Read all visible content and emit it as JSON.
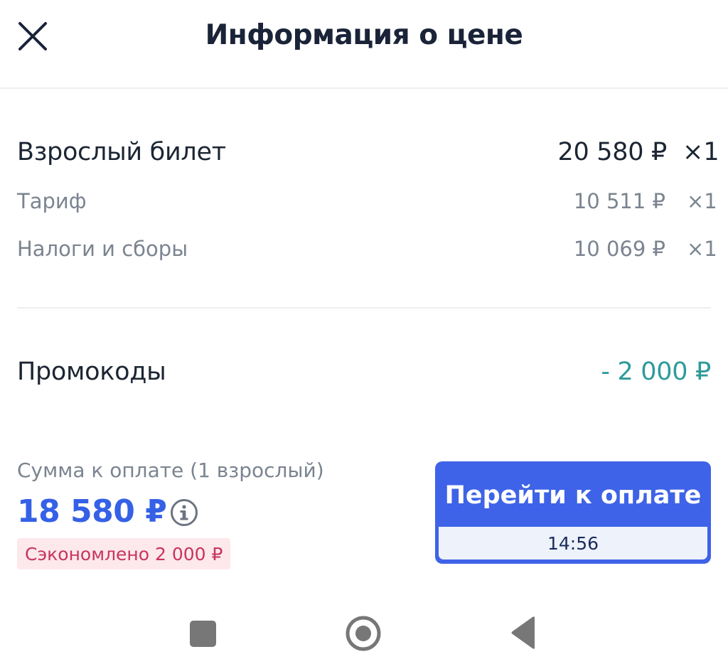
{
  "header": {
    "title": "Информация о цене",
    "close_icon": "close-icon"
  },
  "ticket": {
    "label": "Взрослый билет",
    "price": "20 580 ₽",
    "qty": "×1",
    "items": [
      {
        "label": "Тариф",
        "price": "10 511 ₽",
        "qty": "×1"
      },
      {
        "label": "Налоги и сборы",
        "price": "10 069 ₽",
        "qty": "×1"
      }
    ]
  },
  "promo": {
    "label": "Промокоды",
    "value": "- 2 000 ₽",
    "color": "#2f9a9a"
  },
  "summary": {
    "label": "Сумма к оплате (1 взрослый)",
    "total": "18 580 ₽",
    "total_color": "#3561e6",
    "info_icon": "info-icon",
    "saved": "Сэкономлено 2 000 ₽"
  },
  "pay_button": {
    "label": "Перейти к оплате",
    "timer": "14:56",
    "color": "#3e63e8"
  },
  "nav_bar": {
    "icons": [
      "recent-apps-icon",
      "home-icon",
      "back-icon"
    ]
  }
}
